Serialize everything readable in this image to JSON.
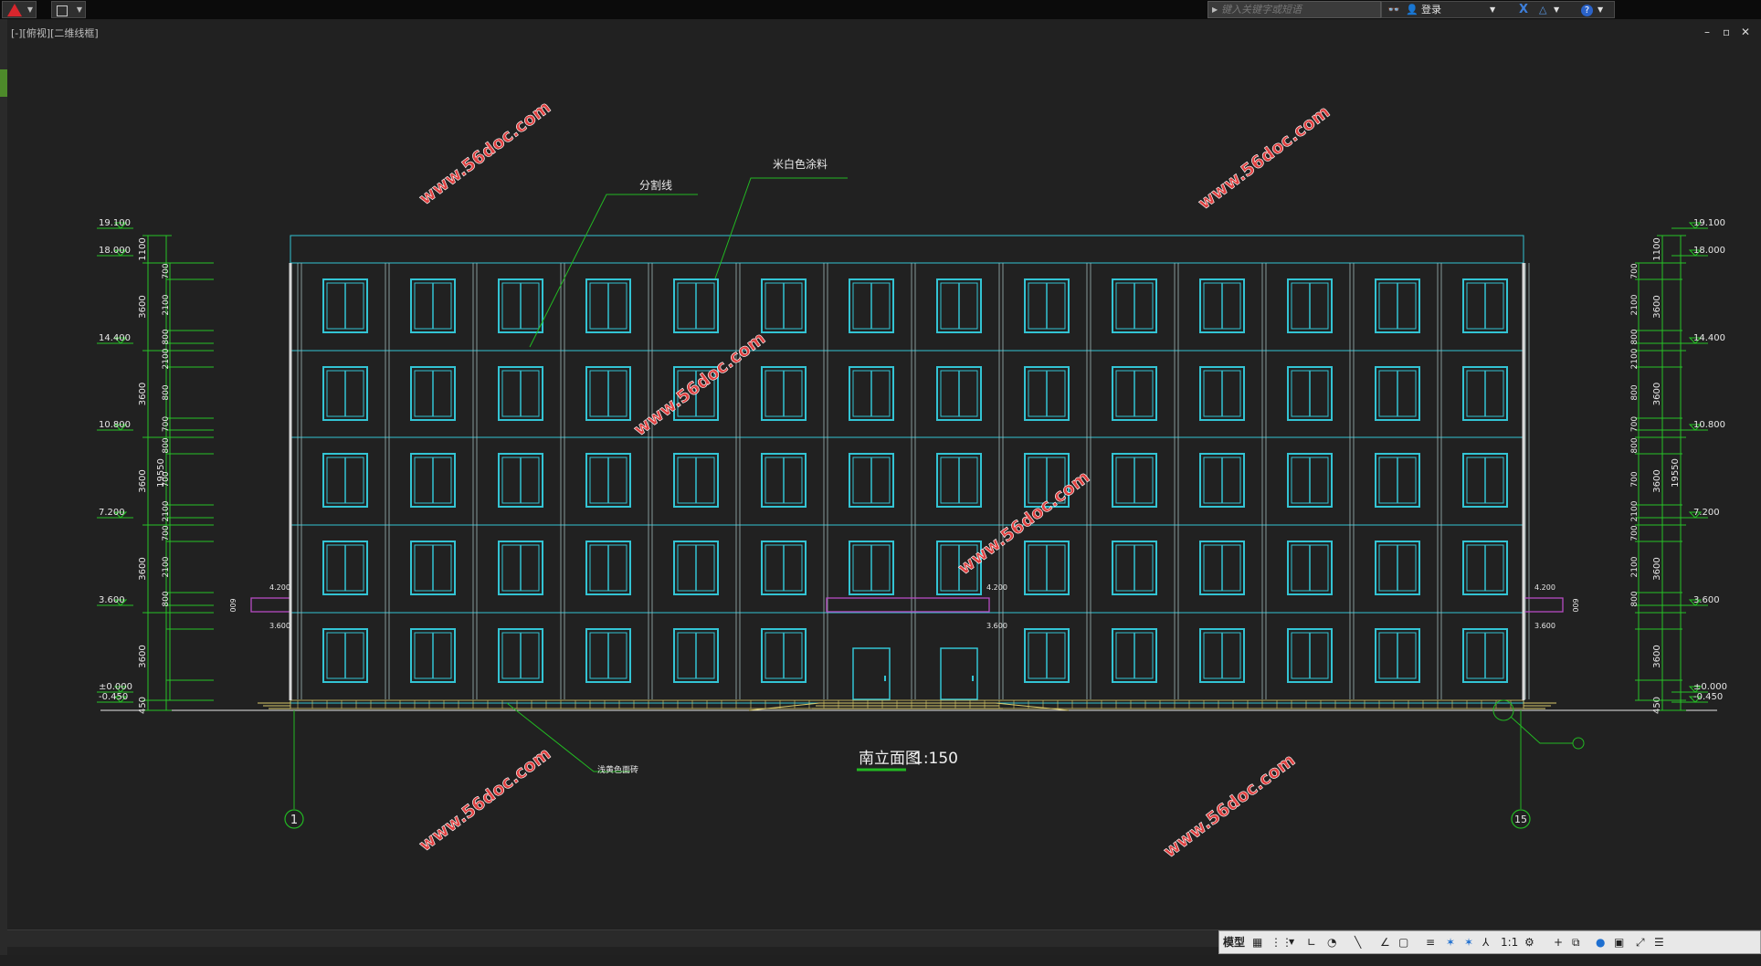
{
  "titlebar": {
    "search_placeholder": "键入关键字或短语",
    "login_label": "登录"
  },
  "viewport": {
    "label": "[-][俯视][二维线框]"
  },
  "drawing": {
    "title": "南立面图",
    "scale": "1:150",
    "callouts": {
      "divider_line": "分割线",
      "white_paint": "米白色涂料",
      "base_note": "浅黄色面砖"
    },
    "watermark": "www.56doc.com",
    "axes": {
      "left": "1",
      "right": "15"
    },
    "elevations": [
      "19.100",
      "18.000",
      "14.400",
      "10.800",
      "7.200",
      "3.600",
      "±0.000",
      "-0.450"
    ],
    "dims_left_outer": [
      "1100",
      "3600",
      "3600",
      "3600",
      "3600",
      "3600",
      "450"
    ],
    "dims_left_inner": [
      "700",
      "2100",
      "800",
      "700",
      "2100",
      "800",
      "700",
      "2100",
      "800",
      "700",
      "2100",
      "800",
      "700",
      "2100",
      "800"
    ],
    "total_height": "19550",
    "canopy_levels": {
      "top": "4.200",
      "bottom": "3.600",
      "dim": "600"
    },
    "door_levels": {
      "top": "4.200",
      "bottom": "3.600"
    }
  },
  "statusbar": {
    "model_label": "模型",
    "scale_label": "1:1"
  },
  "colors": {
    "background": "#212121",
    "facade": "#33c4d4",
    "dimension": "#26c426",
    "leader": "#22b822",
    "watermark": "#e04040",
    "canopy": "#b64cc4",
    "ground": "#d9c96a"
  }
}
